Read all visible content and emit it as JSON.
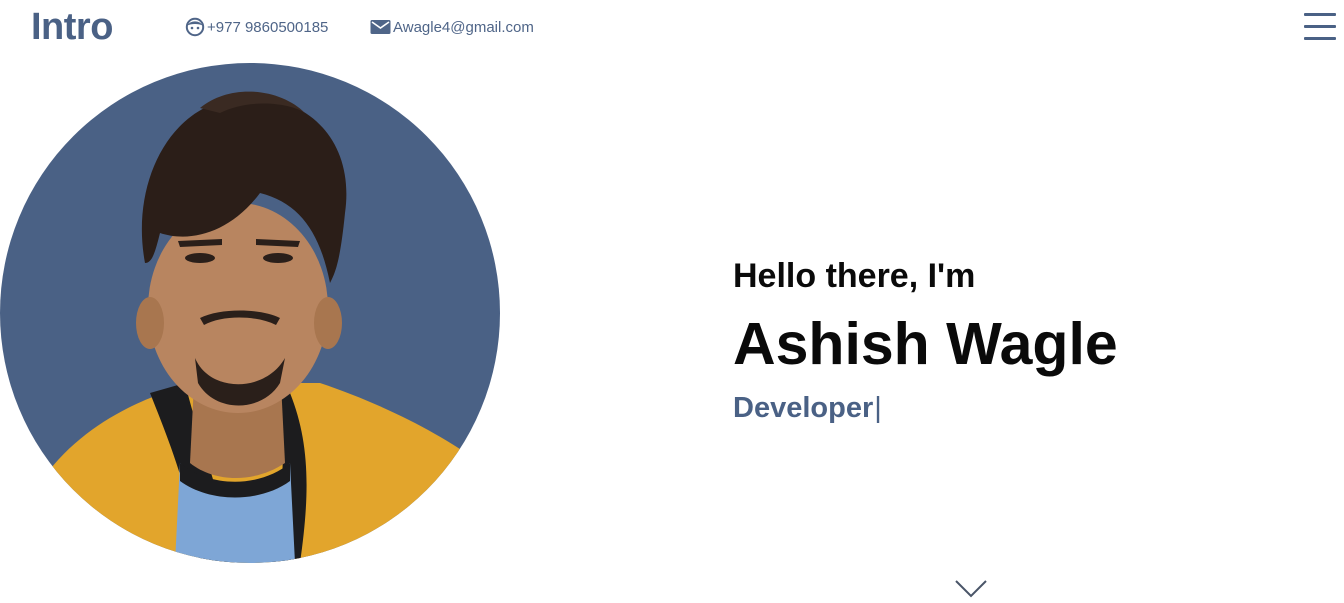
{
  "header": {
    "brand": "Intro",
    "phone": "+977 9860500185",
    "email": "Awagle4@gmail.com",
    "phone_icon": "face-icon",
    "email_icon": "mail-icon",
    "menu_icon": "hamburger-menu-icon"
  },
  "hero": {
    "greeting": "Hello there, I'm",
    "name": "Ashish Wagle",
    "role": "Developer",
    "cursor": "|",
    "scroll_icon": "chevron-down-icon"
  },
  "colors": {
    "accent": "#4a6185",
    "text": "#0a0a0a",
    "background": "#ffffff",
    "jacket": "#e2a52c",
    "shirt": "#7ea6d6"
  }
}
